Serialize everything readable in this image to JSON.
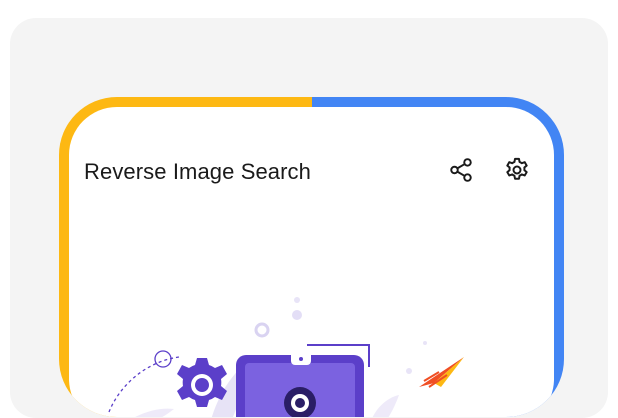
{
  "app": {
    "title": "Reverse Image Search"
  },
  "toolbar": {
    "share_icon": "share-icon",
    "settings_icon": "gear-icon"
  },
  "colors": {
    "frame_left": "#FDB813",
    "frame_right": "#4285F4",
    "illustration_primary": "#5B3FC9",
    "accent_red": "#F04E23",
    "accent_yellow": "#FDB813"
  }
}
